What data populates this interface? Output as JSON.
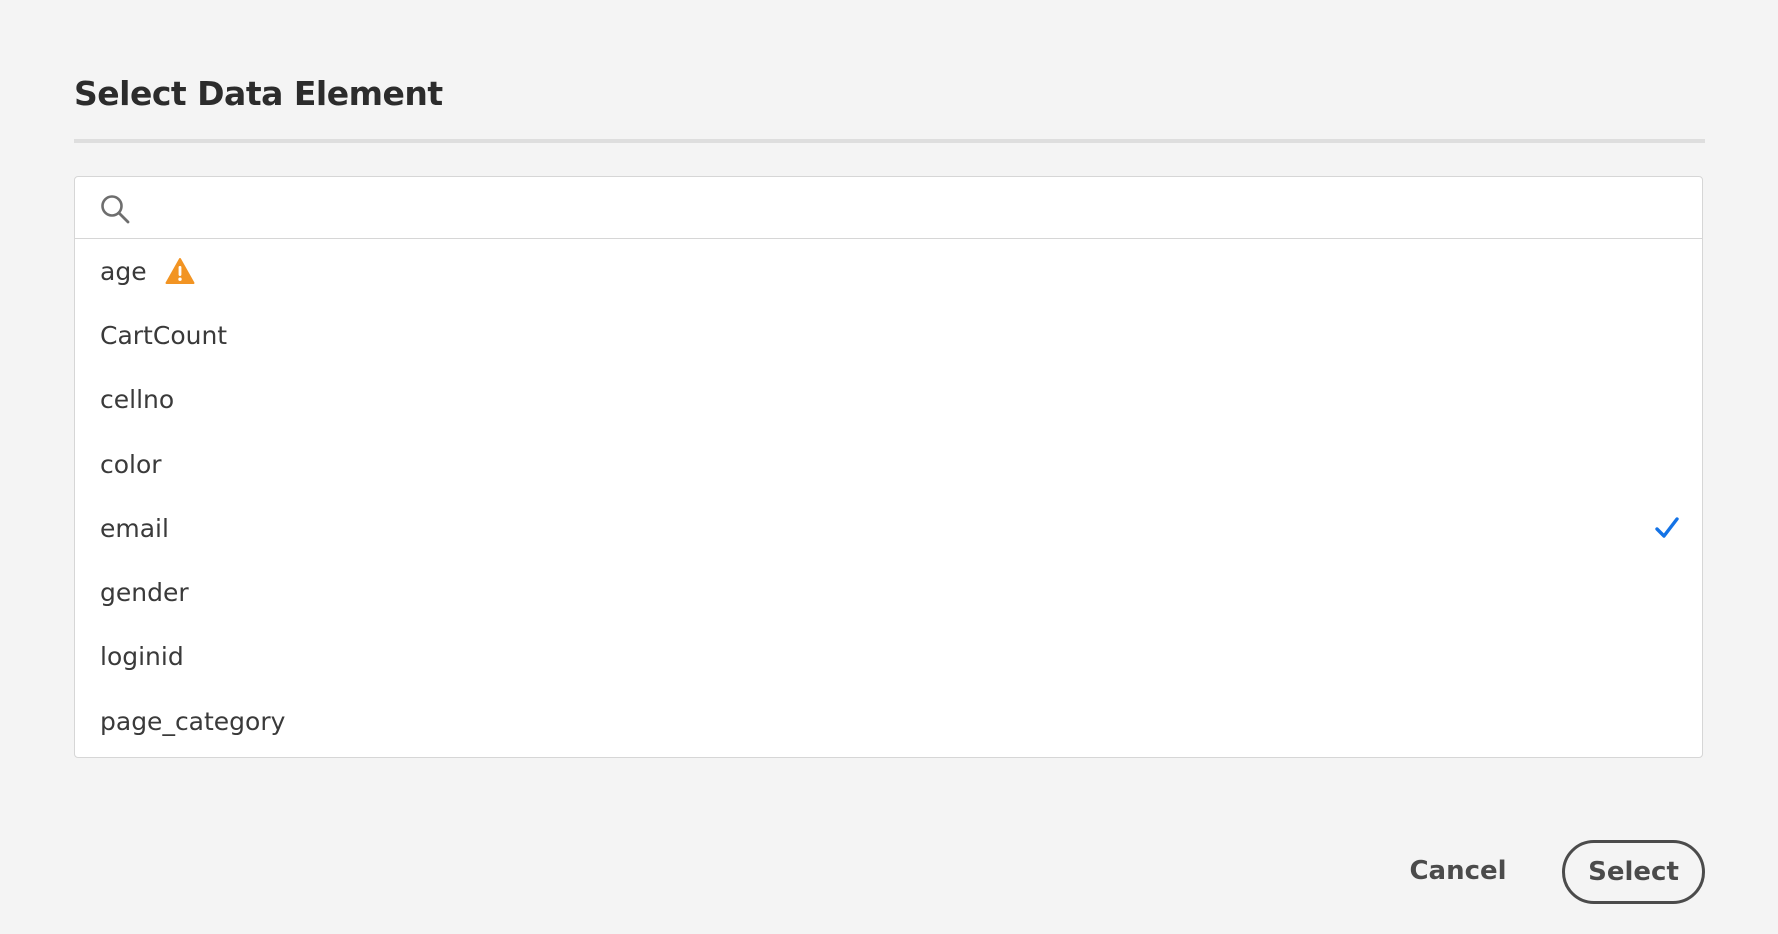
{
  "dialog": {
    "title": "Select Data Element"
  },
  "search": {
    "placeholder": "",
    "value": "",
    "icon": "search-icon"
  },
  "items": [
    {
      "label": "age",
      "warning": true,
      "selected": false
    },
    {
      "label": "CartCount",
      "warning": false,
      "selected": false
    },
    {
      "label": "cellno",
      "warning": false,
      "selected": false
    },
    {
      "label": "color",
      "warning": false,
      "selected": false
    },
    {
      "label": "email",
      "warning": false,
      "selected": true
    },
    {
      "label": "gender",
      "warning": false,
      "selected": false
    },
    {
      "label": "loginid",
      "warning": false,
      "selected": false
    },
    {
      "label": "page_category",
      "warning": false,
      "selected": false
    }
  ],
  "footer": {
    "cancel_label": "Cancel",
    "select_label": "Select"
  },
  "colors": {
    "background": "#f4f4f4",
    "panel": "#ffffff",
    "warning": "#f29423",
    "check": "#1473e6",
    "text": "#2c2c2c",
    "button_outline": "#4b4b4b"
  }
}
